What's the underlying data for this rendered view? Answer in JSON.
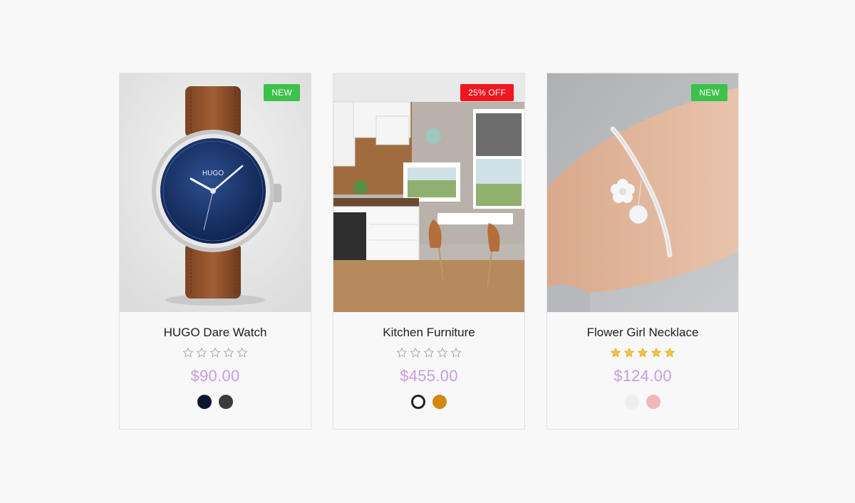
{
  "products": [
    {
      "title": "HUGO Dare Watch",
      "badge": "NEW",
      "badge_color": "#3cc14b",
      "price": "$90.00",
      "rating": 0,
      "image": "watch",
      "watch_brand": "HUGO",
      "swatches": [
        {
          "color": "#0b1631",
          "style": "filled"
        },
        {
          "color": "#3a3a3a",
          "style": "filled"
        }
      ]
    },
    {
      "title": "Kitchen Furniture",
      "badge": "25% OFF",
      "badge_color": "#f0161f",
      "price": "$455.00",
      "rating": 0,
      "image": "kitchen",
      "swatches": [
        {
          "color": "#222222",
          "style": "ring"
        },
        {
          "color": "#d4860f",
          "style": "filled"
        }
      ]
    },
    {
      "title": "Flower Girl Necklace",
      "badge": "NEW",
      "badge_color": "#3cc14b",
      "price": "$124.00",
      "rating": 5,
      "image": "bracelet",
      "swatches": [
        {
          "color": "#eeeeee",
          "style": "filled"
        },
        {
          "color": "#f1b6bb",
          "style": "filled"
        }
      ]
    }
  ]
}
